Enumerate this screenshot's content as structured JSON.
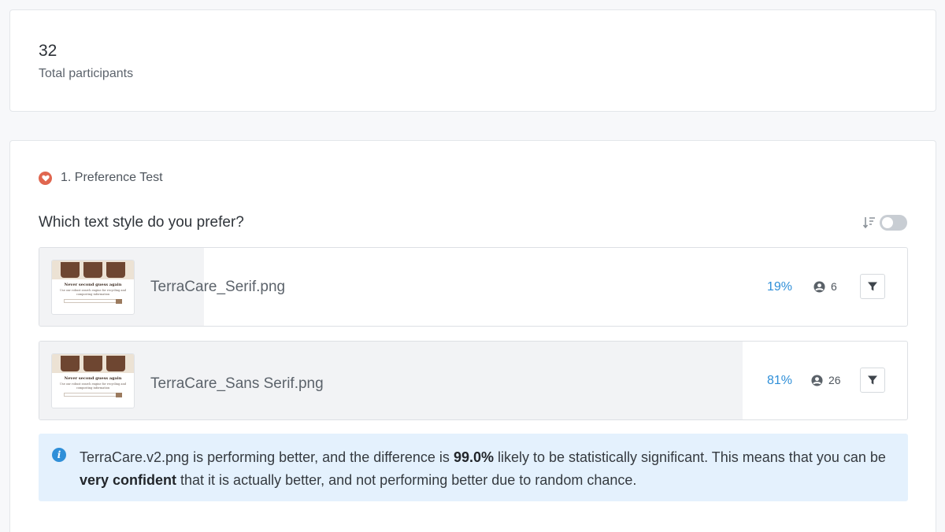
{
  "summary": {
    "total_participants_value": "32",
    "total_participants_label": "Total participants"
  },
  "test": {
    "title": "1. Preference Test",
    "icon": "heart-icon",
    "question": "Which text style do you prefer?",
    "sort_icon": "sort-descending-icon",
    "sort_toggle_on": false,
    "options": [
      {
        "name": "TerraCare_Serif.png",
        "percent_label": "19%",
        "share": 0.19,
        "voters": "6",
        "thumb_heading": "Never second guess again",
        "thumb_text": "Use our robust search engine for recycling and composting information",
        "thumb_placeholder": "Type whatever - it makes sense"
      },
      {
        "name": "TerraCare_Sans Serif.png",
        "percent_label": "81%",
        "share": 0.81,
        "voters": "26",
        "thumb_heading": "Never second guess again",
        "thumb_text": "Use our robust search engine for recycling and composting information",
        "thumb_placeholder": "Type whatever - it makes sense"
      }
    ],
    "info": {
      "part1": "TerraCare.v2.png is performing better, and the difference is ",
      "highlight1": "99.0%",
      "part2": " likely to be statistically significant. This means that you can be ",
      "highlight2": "very confident",
      "part3": " that it is actually better, and not performing better due to random chance."
    }
  },
  "colors": {
    "accent": "#2f8fd8",
    "heart_badge": "#e0664f",
    "info_background": "#e4f1fd",
    "result_bar": "#f2f3f5"
  }
}
